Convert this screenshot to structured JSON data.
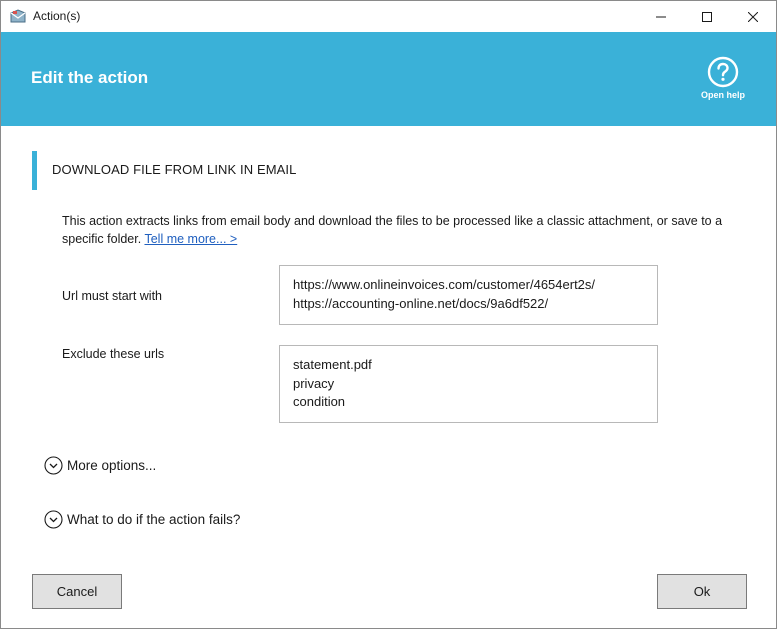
{
  "window": {
    "title": "Action(s)"
  },
  "header": {
    "title": "Edit the action",
    "help_label": "Open help"
  },
  "section": {
    "title": "DOWNLOAD FILE FROM LINK IN EMAIL",
    "description": "This action extracts links from email body and download the files to be processed like a classic attachment, or save to a specific folder.",
    "link_text": "Tell me more... >"
  },
  "fields": {
    "url_label": "Url must start with",
    "url_value": "https://www.onlineinvoices.com/customer/4654ert2s/\nhttps://accounting-online.net/docs/9a6df522/",
    "exclude_label": "Exclude these urls",
    "exclude_value": "statement.pdf\nprivacy\ncondition"
  },
  "expanders": {
    "more_options": "More options...",
    "on_fail": "What to do if the action fails?"
  },
  "buttons": {
    "cancel": "Cancel",
    "ok": "Ok"
  },
  "colors": {
    "accent": "#3ab1d8",
    "link": "#1f5fbf"
  }
}
